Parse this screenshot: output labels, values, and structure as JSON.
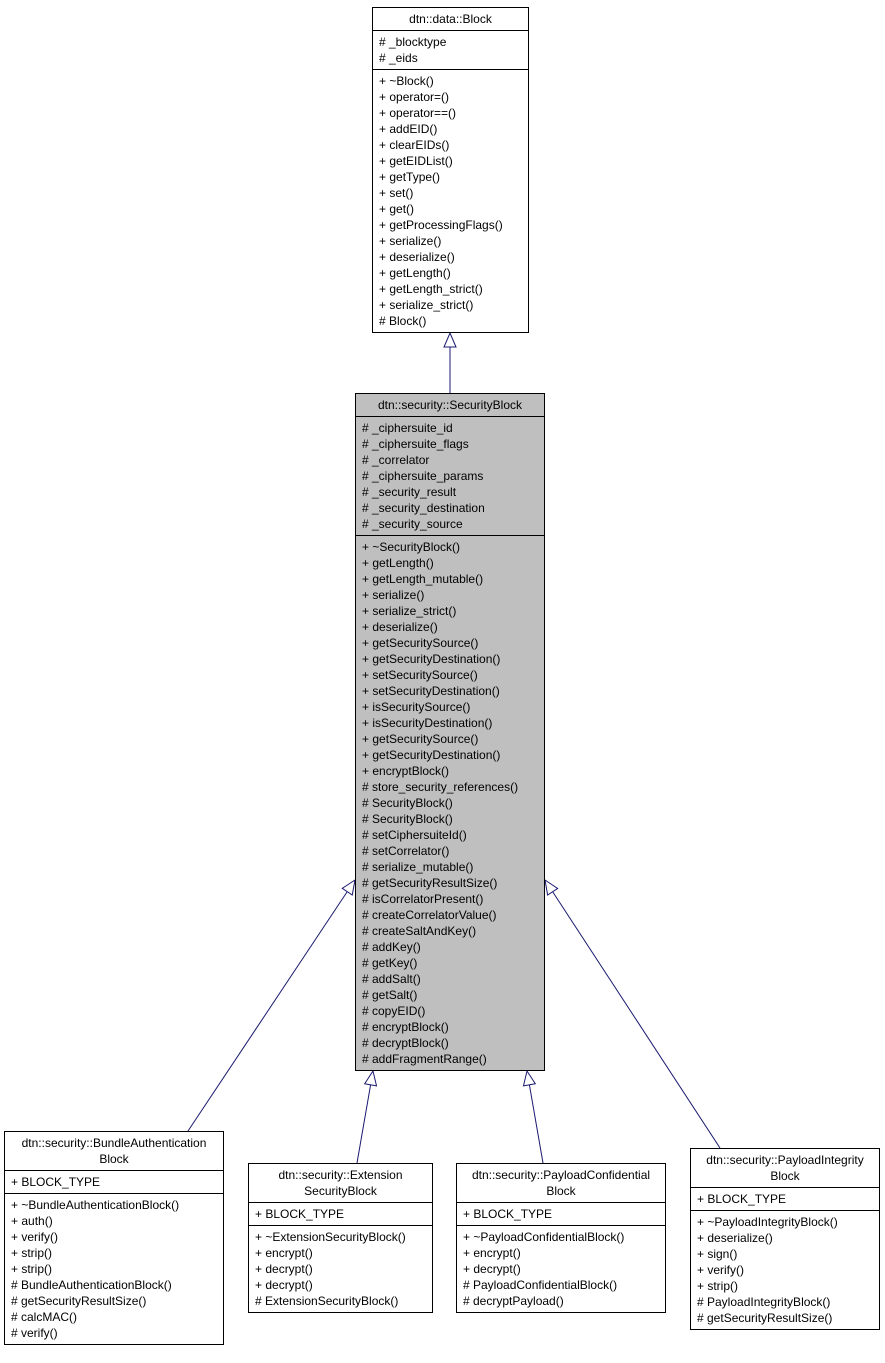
{
  "diagram": {
    "type": "class-inheritance",
    "edge_color": "#191970",
    "focus_color": "#bfbfbf",
    "classes": {
      "block": {
        "name": "dtn::data::Block",
        "attributes": [
          "# _blocktype",
          "# _eids"
        ],
        "methods": [
          "+ ~Block()",
          "+ operator=()",
          "+ operator==()",
          "+ addEID()",
          "+ clearEIDs()",
          "+ getEIDList()",
          "+ getType()",
          "+ set()",
          "+ get()",
          "+ getProcessingFlags()",
          "+ serialize()",
          "+ deserialize()",
          "+ getLength()",
          "+ getLength_strict()",
          "+ serialize_strict()",
          "# Block()"
        ]
      },
      "security_block": {
        "name": "dtn::security::SecurityBlock",
        "attributes": [
          "# _ciphersuite_id",
          "# _ciphersuite_flags",
          "# _correlator",
          "# _ciphersuite_params",
          "# _security_result",
          "# _security_destination",
          "# _security_source"
        ],
        "methods": [
          "+ ~SecurityBlock()",
          "+ getLength()",
          "+ getLength_mutable()",
          "+ serialize()",
          "+ serialize_strict()",
          "+ deserialize()",
          "+ getSecuritySource()",
          "+ getSecurityDestination()",
          "+ setSecuritySource()",
          "+ setSecurityDestination()",
          "+ isSecuritySource()",
          "+ isSecurityDestination()",
          "+ getSecuritySource()",
          "+ getSecurityDestination()",
          "+ encryptBlock()",
          "# store_security_references()",
          "# SecurityBlock()",
          "# SecurityBlock()",
          "# setCiphersuiteId()",
          "# setCorrelator()",
          "# serialize_mutable()",
          "# getSecurityResultSize()",
          "# isCorrelatorPresent()",
          "# createCorrelatorValue()",
          "# createSaltAndKey()",
          "# addKey()",
          "# getKey()",
          "# addSalt()",
          "# getSalt()",
          "# copyEID()",
          "# encryptBlock()",
          "# decryptBlock()",
          "# addFragmentRange()"
        ]
      },
      "bab": {
        "name": "dtn::security::BundleAuthentication\nBlock",
        "attributes": [
          "+ BLOCK_TYPE"
        ],
        "methods": [
          "+ ~BundleAuthenticationBlock()",
          "+ auth()",
          "+ verify()",
          "+ strip()",
          "+ strip()",
          "# BundleAuthenticationBlock()",
          "# getSecurityResultSize()",
          "# calcMAC()",
          "# verify()"
        ]
      },
      "esb": {
        "name": "dtn::security::Extension\nSecurityBlock",
        "attributes": [
          "+ BLOCK_TYPE"
        ],
        "methods": [
          "+ ~ExtensionSecurityBlock()",
          "+ encrypt()",
          "+ decrypt()",
          "+ decrypt()",
          "# ExtensionSecurityBlock()"
        ]
      },
      "pcb": {
        "name": "dtn::security::PayloadConfidential\nBlock",
        "attributes": [
          "+ BLOCK_TYPE"
        ],
        "methods": [
          "+ ~PayloadConfidentialBlock()",
          "+ encrypt()",
          "+ decrypt()",
          "# PayloadConfidentialBlock()",
          "# decryptPayload()"
        ]
      },
      "pib": {
        "name": "dtn::security::PayloadIntegrity\nBlock",
        "attributes": [
          "+ BLOCK_TYPE"
        ],
        "methods": [
          "+ ~PayloadIntegrityBlock()",
          "+ deserialize()",
          "+ sign()",
          "+ verify()",
          "+ strip()",
          "# PayloadIntegrityBlock()",
          "# getSecurityResultSize()"
        ]
      }
    },
    "inheritance": [
      {
        "child": "security_block",
        "parent": "block"
      },
      {
        "child": "bab",
        "parent": "security_block"
      },
      {
        "child": "esb",
        "parent": "security_block"
      },
      {
        "child": "pcb",
        "parent": "security_block"
      },
      {
        "child": "pib",
        "parent": "security_block"
      }
    ]
  }
}
